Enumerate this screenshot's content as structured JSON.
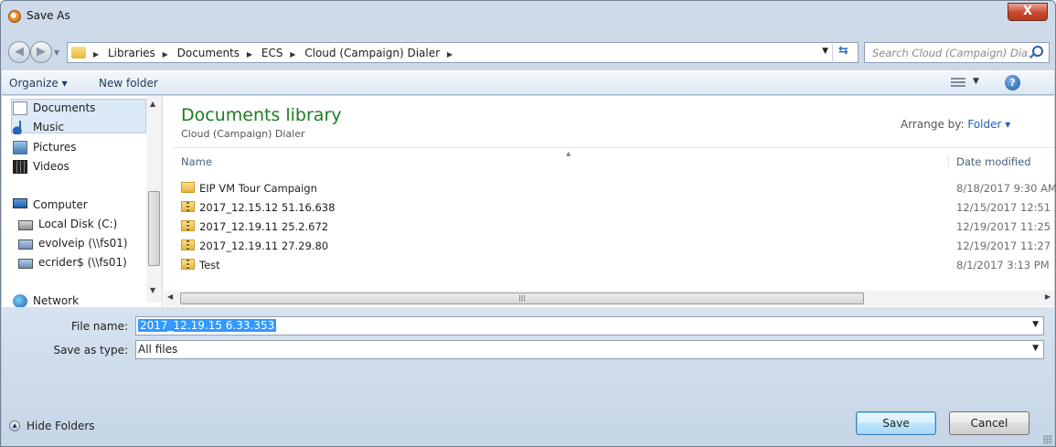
{
  "window": {
    "title": "Save As",
    "close_label": "X"
  },
  "nav": {
    "breadcrumb": [
      "Libraries",
      "Documents",
      "ECS",
      "Cloud (Campaign) Dialer"
    ],
    "search_placeholder": "Search Cloud (Campaign) Dia..."
  },
  "toolbar": {
    "organize_label": "Organize ▾",
    "new_folder_label": "New folder",
    "help_label": "?"
  },
  "sidebar": {
    "items": [
      {
        "label": "Documents",
        "icon": "document-icon"
      },
      {
        "label": "Music",
        "icon": "music-icon"
      },
      {
        "label": "Pictures",
        "icon": "pictures-icon"
      },
      {
        "label": "Videos",
        "icon": "videos-icon"
      },
      {
        "label": "Computer",
        "icon": "computer-icon"
      },
      {
        "label": "Local Disk (C:)",
        "icon": "disk-icon"
      },
      {
        "label": "evolveip (\\\\fs01)",
        "icon": "network-drive-icon"
      },
      {
        "label": "ecrider$ (\\\\fs01)",
        "icon": "network-drive-icon"
      },
      {
        "label": "Network",
        "icon": "network-icon"
      }
    ]
  },
  "library": {
    "title": "Documents library",
    "subtitle": "Cloud (Campaign) Dialer",
    "arrange_label": "Arrange by:",
    "arrange_value": "Folder ▾"
  },
  "table": {
    "columns": [
      "Name",
      "Date modified"
    ],
    "rows": [
      {
        "name": "EIP VM Tour Campaign",
        "date": "8/18/2017 9:30 AM",
        "type": "folder"
      },
      {
        "name": "2017_12.15.12 51.16.638",
        "date": "12/15/2017 12:51 ...",
        "type": "zip"
      },
      {
        "name": "2017_12.19.11 25.2.672",
        "date": "12/19/2017 11:25 ...",
        "type": "zip"
      },
      {
        "name": "2017_12.19.11 27.29.80",
        "date": "12/19/2017 11:27 ...",
        "type": "zip"
      },
      {
        "name": "Test",
        "date": "8/1/2017 3:13 PM",
        "type": "zip"
      }
    ]
  },
  "form": {
    "file_name_label": "File name:",
    "file_name_value": "2017_12.19.15 6.33.353",
    "save_type_label": "Save as type:",
    "save_type_value": "All files"
  },
  "footer": {
    "hide_folders_label": "Hide Folders",
    "save_label": "Save",
    "cancel_label": "Cancel"
  },
  "colors": {
    "library_title": "#1e7c22",
    "selection": "#3399ff",
    "link": "#1e5fae"
  }
}
